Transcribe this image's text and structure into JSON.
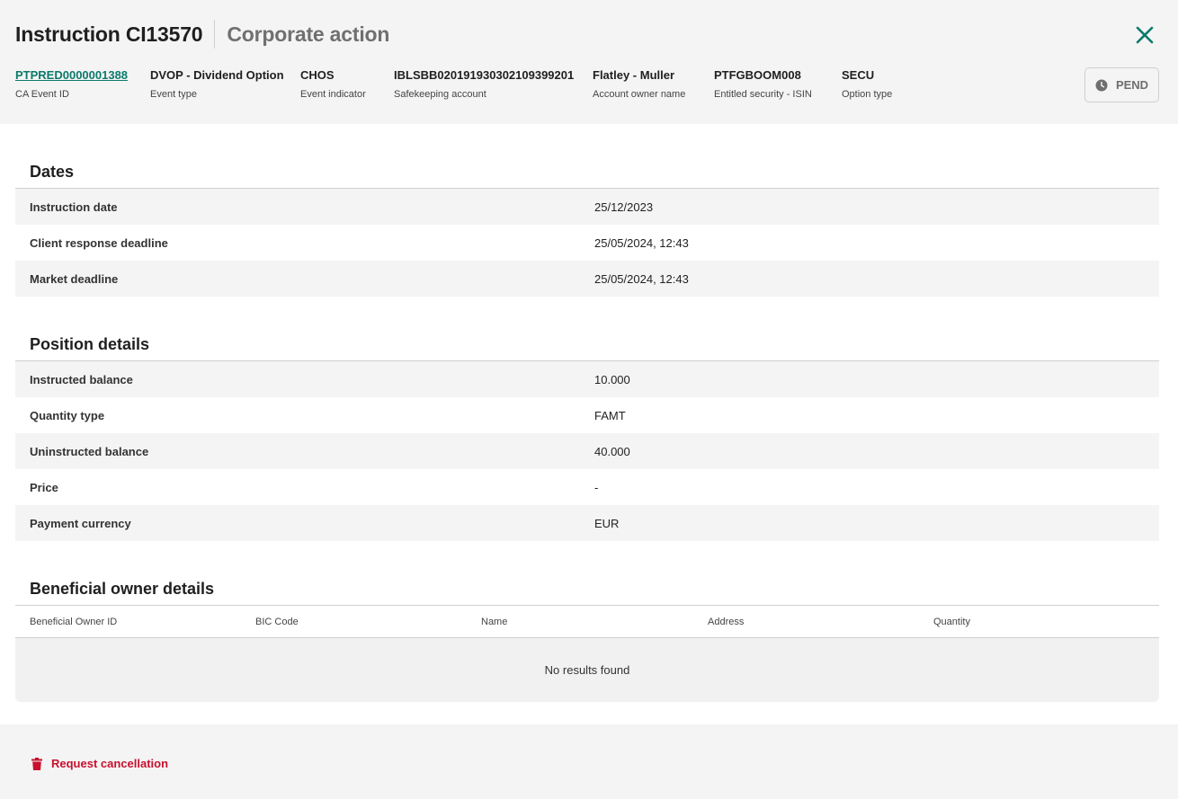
{
  "header": {
    "title": "Instruction CI13570",
    "subtitle": "Corporate action",
    "close_icon": "close-icon",
    "accent_color": "#0b7a6b"
  },
  "meta": [
    {
      "value": "PTPRED0000001388",
      "label": "CA Event ID"
    },
    {
      "value": "DVOP - Dividend Option",
      "label": "Event type"
    },
    {
      "value": "CHOS",
      "label": "Event indicator"
    },
    {
      "value": "IBLSBB020191930302109399201",
      "label": "Safekeeping account"
    },
    {
      "value": "Flatley - Muller",
      "label": "Account owner name"
    },
    {
      "value": "PTFGBOOM008",
      "label": "Entitled security - ISIN"
    },
    {
      "value": "SECU",
      "label": "Option type"
    }
  ],
  "status": {
    "label": "PEND",
    "icon": "clock-icon"
  },
  "dates": {
    "title": "Dates",
    "rows": [
      {
        "key": "Instruction date",
        "value": "25/12/2023"
      },
      {
        "key": "Client response deadline",
        "value": "25/05/2024, 12:43"
      },
      {
        "key": "Market deadline",
        "value": "25/05/2024, 12:43"
      }
    ]
  },
  "position": {
    "title": "Position details",
    "rows": [
      {
        "key": "Instructed balance",
        "value": "10.000"
      },
      {
        "key": "Quantity type",
        "value": "FAMT"
      },
      {
        "key": "Uninstructed balance",
        "value": "40.000"
      },
      {
        "key": "Price",
        "value": "-"
      },
      {
        "key": "Payment currency",
        "value": "EUR"
      }
    ]
  },
  "beneficial": {
    "title": "Beneficial owner details",
    "columns": [
      "Beneficial Owner ID",
      "BIC Code",
      "Name",
      "Address",
      "Quantity"
    ],
    "empty_text": "No results found"
  },
  "footer": {
    "cancel_label": "Request cancellation",
    "cancel_icon": "trash-icon",
    "danger_color": "#c8102e"
  }
}
